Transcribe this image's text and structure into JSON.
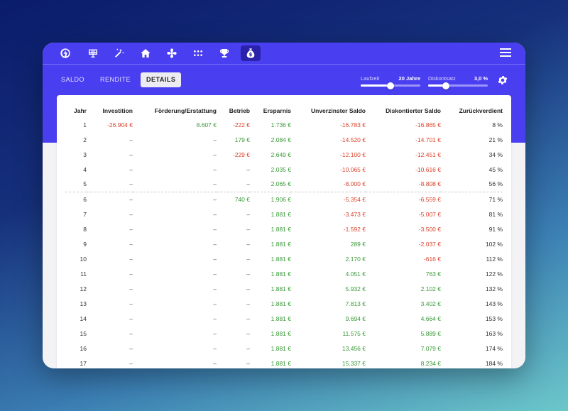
{
  "nav": {
    "icons": [
      "logo-icon",
      "grid-panel-icon",
      "magic-wand-icon",
      "home-icon",
      "fan-icon",
      "apps-grid-icon",
      "trophy-icon",
      "money-bag-icon"
    ],
    "active": "money-bag-icon"
  },
  "tabs": [
    {
      "label": "SALDO",
      "active": false
    },
    {
      "label": "RENDITE",
      "active": false
    },
    {
      "label": "DETAILS",
      "active": true
    }
  ],
  "controls": {
    "laufzeit": {
      "label": "Laufzeit",
      "value": "20 Jahre",
      "fraction": 0.5
    },
    "diskontsatz": {
      "label": "Diskontsatz",
      "value": "3,0 %",
      "fraction": 0.3
    }
  },
  "colors": {
    "accent": "#4a3ff0",
    "negative": "#d9452f",
    "positive": "#3a9a3a"
  },
  "table": {
    "columns": [
      "Jahr",
      "Investition",
      "Förderung/Erstattung",
      "Betrieb",
      "Ersparnis",
      "Unverzinster Saldo",
      "Diskontierter Saldo",
      "Zurückverdient"
    ],
    "rows": [
      [
        "1",
        "-26.904 €",
        "8.607 €",
        "-222 €",
        "1.736 €",
        "-16.783 €",
        "-16.865 €",
        "8 %"
      ],
      [
        "2",
        "–",
        "–",
        "179 €",
        "2.084 €",
        "-14.520 €",
        "-14.701 €",
        "21 %"
      ],
      [
        "3",
        "–",
        "–",
        "-229 €",
        "2.649 €",
        "-12.100 €",
        "-12.451 €",
        "34 %"
      ],
      [
        "4",
        "–",
        "–",
        "–",
        "2.035 €",
        "-10.065 €",
        "-10.616 €",
        "45 %"
      ],
      [
        "5",
        "–",
        "–",
        "–",
        "2.065 €",
        "-8.000 €",
        "-8.808 €",
        "56 %"
      ],
      [
        "6",
        "–",
        "–",
        "740 €",
        "1.906 €",
        "-5.354 €",
        "-6.559 €",
        "71 %"
      ],
      [
        "7",
        "–",
        "–",
        "–",
        "1.881 €",
        "-3.473 €",
        "-5.007 €",
        "81 %"
      ],
      [
        "8",
        "–",
        "–",
        "–",
        "1.881 €",
        "-1.592 €",
        "-3.500 €",
        "91 %"
      ],
      [
        "9",
        "–",
        "–",
        "–",
        "1.881 €",
        "289 €",
        "-2.037 €",
        "102 %"
      ],
      [
        "10",
        "–",
        "–",
        "–",
        "1.881 €",
        "2.170 €",
        "-616 €",
        "112 %"
      ],
      [
        "11",
        "–",
        "–",
        "–",
        "1.881 €",
        "4.051 €",
        "763 €",
        "122 %"
      ],
      [
        "12",
        "–",
        "–",
        "–",
        "1.881 €",
        "5.932 €",
        "2.102 €",
        "132 %"
      ],
      [
        "13",
        "–",
        "–",
        "–",
        "1.881 €",
        "7.813 €",
        "3.402 €",
        "143 %"
      ],
      [
        "14",
        "–",
        "–",
        "–",
        "1.881 €",
        "9.694 €",
        "4.664 €",
        "153 %"
      ],
      [
        "15",
        "–",
        "–",
        "–",
        "1.881 €",
        "11.575 €",
        "5.889 €",
        "163 %"
      ],
      [
        "16",
        "–",
        "–",
        "–",
        "1.881 €",
        "13.456 €",
        "7.079 €",
        "174 %"
      ],
      [
        "17",
        "–",
        "–",
        "–",
        "1.881 €",
        "15.337 €",
        "8.234 €",
        "184 %"
      ]
    ],
    "separator_after_row": 4
  }
}
